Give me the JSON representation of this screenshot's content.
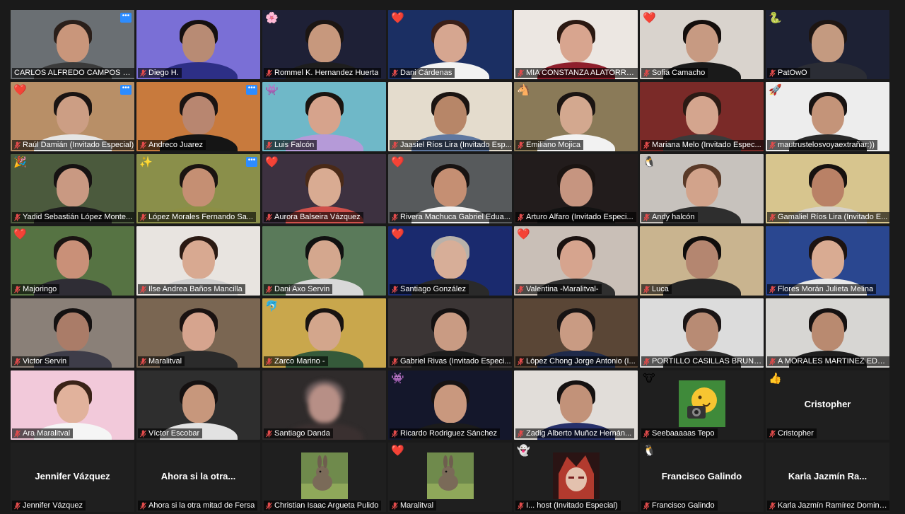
{
  "meeting": {
    "view": "gallery",
    "active_speaker": "CARLOS ALFREDO CAMPOS DE L..."
  },
  "participants": [
    {
      "name": "CARLOS ALFREDO CAMPOS DE L...",
      "video": true,
      "muted": false,
      "reaction": "",
      "menu": true,
      "active": true,
      "bg": "#6a6f73",
      "skin": "#c9967b",
      "hair": "#2a1f1a",
      "shirt": "#3b3b3b"
    },
    {
      "name": "Diego H.",
      "video": true,
      "muted": true,
      "reaction": "",
      "menu": false,
      "bg": "#7a6fd6",
      "skin": "#b88b74",
      "hair": "#151010",
      "shirt": "#2d2f86"
    },
    {
      "name": "Rommel K. Hernandez Huerta",
      "video": true,
      "muted": true,
      "reaction": "🌸",
      "menu": false,
      "bg": "#1e2036",
      "skin": "#c7987d",
      "hair": "#1b1513",
      "shirt": "#1e1e1e"
    },
    {
      "name": "Dani Cárdenas",
      "video": true,
      "muted": true,
      "reaction": "❤️",
      "menu": false,
      "bg": "#1b2f63",
      "skin": "#d6a690",
      "hair": "#3a1f18",
      "shirt": "#f2f2f2"
    },
    {
      "name": "MIA CONSTANZA ALATORRE ...",
      "video": true,
      "muted": true,
      "reaction": "",
      "menu": false,
      "bg": "#ece7e2",
      "skin": "#d8a58f",
      "hair": "#2b1912",
      "shirt": "#8f1f2c"
    },
    {
      "name": "Sofia Camacho",
      "video": true,
      "muted": true,
      "reaction": "❤️",
      "menu": false,
      "bg": "#d9d3cd",
      "skin": "#c79a82",
      "hair": "#140e0c",
      "shirt": "#1a1a1a"
    },
    {
      "name": "PatOwO",
      "video": true,
      "muted": true,
      "reaction": "🐍",
      "menu": false,
      "bg": "#1d2134",
      "skin": "#c49a80",
      "hair": "#1d1512",
      "shirt": "#2b2d35"
    },
    {
      "name": "Raúl Damián (Invitado Especial)",
      "video": true,
      "muted": true,
      "reaction": "❤️",
      "menu": true,
      "bg": "#b88f67",
      "skin": "#cc9e84",
      "hair": "#1a1412",
      "shirt": "#e5e5e5"
    },
    {
      "name": "Andreco Juarez",
      "video": true,
      "muted": true,
      "reaction": "",
      "menu": true,
      "bg": "#c87a3d",
      "skin": "#b88670",
      "hair": "#191312",
      "shirt": "#151515"
    },
    {
      "name": "Luis Falcón",
      "video": true,
      "muted": true,
      "reaction": "👾",
      "menu": false,
      "bg": "#6fb8c8",
      "skin": "#d6a38c",
      "hair": "#1a1410",
      "shirt": "#b59ad8"
    },
    {
      "name": "Jaasiel Ríos Lira (Invitado Esp...",
      "video": true,
      "muted": true,
      "reaction": "",
      "menu": false,
      "bg": "#e4dccd",
      "skin": "#b78668",
      "hair": "#1b1411",
      "shirt": "#5f78a0"
    },
    {
      "name": "Emiliano Mojica",
      "video": true,
      "muted": true,
      "reaction": "🐴",
      "menu": false,
      "bg": "#8a7a58",
      "skin": "#d3a88f",
      "hair": "#1a1412",
      "shirt": "#f2f2f2"
    },
    {
      "name": "Mariana Melo (Invitado Espec...",
      "video": true,
      "muted": true,
      "reaction": "",
      "menu": false,
      "bg": "#7a2a28",
      "skin": "#d4a58e",
      "hair": "#2b1a14",
      "shirt": "#3a3a3a"
    },
    {
      "name": "mautrustelosvoyaextrañar:))",
      "video": true,
      "muted": true,
      "reaction": "🚀",
      "menu": false,
      "bg": "#ededed",
      "skin": "#c49479",
      "hair": "#181312",
      "shirt": "#2a2a2a"
    },
    {
      "name": "Yadid Sebastián López Monte...",
      "video": true,
      "muted": true,
      "reaction": "🎉",
      "menu": false,
      "bg": "#4b5a3d",
      "skin": "#c99982",
      "hair": "#161212",
      "shirt": "#1d1d1d"
    },
    {
      "name": "López Morales Fernando Sa...",
      "video": true,
      "muted": true,
      "reaction": "✨",
      "menu": true,
      "bg": "#8a8f4a",
      "skin": "#c58f73",
      "hair": "#1b1411",
      "shirt": "#8c8f45"
    },
    {
      "name": "Aurora Balseira Vázquez",
      "video": true,
      "muted": true,
      "reaction": "❤️",
      "menu": false,
      "bg": "#3d3140",
      "skin": "#d9ab92",
      "hair": "#4a2a18",
      "shirt": "#d0504b"
    },
    {
      "name": "Rivera Machuca Gabriel Edua...",
      "video": true,
      "muted": true,
      "reaction": "❤️",
      "menu": false,
      "bg": "#575a5c",
      "skin": "#c58f73",
      "hair": "#181312",
      "shirt": "#f0f0f0"
    },
    {
      "name": "Arturo Alfaro (Invitado Especi...",
      "video": true,
      "muted": true,
      "reaction": "",
      "menu": false,
      "bg": "#221c1c",
      "skin": "#c69580",
      "hair": "#1a1412",
      "shirt": "#121212"
    },
    {
      "name": "Andy halcón",
      "video": true,
      "muted": true,
      "reaction": "🐧",
      "menu": false,
      "bg": "#c7c2bd",
      "skin": "#d2a38b",
      "hair": "#5a3a28",
      "shirt": "#2e2e2e"
    },
    {
      "name": "Gamaliel Ríos Lira (Invitado E...",
      "video": true,
      "muted": true,
      "reaction": "",
      "menu": false,
      "bg": "#d7c58e",
      "skin": "#b98166",
      "hair": "#171210",
      "shirt": "#d7d2c8"
    },
    {
      "name": "Majoringo",
      "video": true,
      "muted": true,
      "reaction": "❤️",
      "menu": false,
      "bg": "#567343",
      "skin": "#c99078",
      "hair": "#1a1412",
      "shirt": "#2f2d35"
    },
    {
      "name": "Ilse Andrea Baños Mancilla",
      "video": true,
      "muted": true,
      "reaction": "",
      "menu": false,
      "bg": "#e8e4e0",
      "skin": "#d8a991",
      "hair": "#2b1a13",
      "shirt": "#cfcfcf"
    },
    {
      "name": "Dani Axo Servin",
      "video": true,
      "muted": true,
      "reaction": "",
      "menu": false,
      "bg": "#5a7a5a",
      "skin": "#d4a78e",
      "hair": "#111111",
      "shirt": "#d8d8d8"
    },
    {
      "name": "Santiago González",
      "video": true,
      "muted": true,
      "reaction": "❤️",
      "menu": false,
      "bg": "#1a2a6e",
      "skin": "#d7ae98",
      "hair": "#b8b1aa",
      "shirt": "#2a2a2a"
    },
    {
      "name": "Valentina -Maralitval-",
      "video": true,
      "muted": true,
      "reaction": "❤️",
      "menu": false,
      "bg": "#c9bfb7",
      "skin": "#d6a48e",
      "hair": "#1a1210",
      "shirt": "#2f2f2f"
    },
    {
      "name": "Luca",
      "video": true,
      "muted": true,
      "reaction": "",
      "menu": false,
      "bg": "#c9b48f",
      "skin": "#b48670",
      "hair": "#0f0d0c",
      "shirt": "#252525"
    },
    {
      "name": "Flores Morán Julieta Melina",
      "video": true,
      "muted": true,
      "reaction": "",
      "menu": false,
      "bg": "#2a4790",
      "skin": "#d9ab92",
      "hair": "#1c1311",
      "shirt": "#e8e8e8"
    },
    {
      "name": "Victor Servin",
      "video": true,
      "muted": true,
      "reaction": "",
      "menu": false,
      "bg": "#8a8078",
      "skin": "#aa7c68",
      "hair": "#141111",
      "shirt": "#3e3d49"
    },
    {
      "name": "Maralitval",
      "video": true,
      "muted": true,
      "reaction": "",
      "menu": false,
      "bg": "#7a6652",
      "skin": "#d6a48e",
      "hair": "#1a1211",
      "shirt": "#2b2b2b"
    },
    {
      "name": "Zarco Marino -",
      "video": true,
      "muted": true,
      "reaction": "🐬",
      "menu": false,
      "bg": "#c9a74c",
      "skin": "#d3a68c",
      "hair": "#181311",
      "shirt": "#355a3a"
    },
    {
      "name": "Gabriel Rivas (Invitado Especi...",
      "video": true,
      "muted": true,
      "reaction": "",
      "menu": false,
      "bg": "#3b3535",
      "skin": "#c99b83",
      "hair": "#141111",
      "shirt": "#1d1d1d"
    },
    {
      "name": "López Chong Jorge Antonio (I...",
      "video": true,
      "muted": true,
      "reaction": "",
      "menu": false,
      "bg": "#5a4636",
      "skin": "#c99b83",
      "hair": "#171313",
      "shirt": "#1f2a4a"
    },
    {
      "name": "PORTILLO CASILLAS BRUNO E...",
      "video": true,
      "muted": true,
      "reaction": "",
      "menu": false,
      "bg": "#dcdcdc",
      "skin": "#b88b74",
      "hair": "#1b1515",
      "shirt": "#2b2b2b"
    },
    {
      "name": "A MORALES MARTINEZ EDGA...",
      "video": true,
      "muted": true,
      "reaction": "",
      "menu": false,
      "bg": "#d7d6d3",
      "skin": "#b98a70",
      "hair": "#151111",
      "shirt": "#1e1e1e"
    },
    {
      "name": "Ara Maralitval",
      "video": true,
      "muted": true,
      "reaction": "",
      "menu": false,
      "bg": "#f2c9da",
      "skin": "#e1b29c",
      "hair": "#3a2318",
      "shirt": "#f5f5f5"
    },
    {
      "name": "Víctor Escobar",
      "video": true,
      "muted": true,
      "reaction": "",
      "menu": false,
      "bg": "#2e2e2e",
      "skin": "#c7977c",
      "hair": "#151111",
      "shirt": "#e2e2e2"
    },
    {
      "name": "Santiago Danda",
      "video": true,
      "muted": true,
      "reaction": "",
      "menu": false,
      "bg": "#2f2b2b",
      "skin": "#b78f86",
      "hair": "#6a5a5a",
      "shirt": "#3a3030",
      "blurred": true
    },
    {
      "name": "Ricardo Rodriguez Sánchez",
      "video": true,
      "muted": true,
      "reaction": "👾",
      "menu": false,
      "bg": "#14172b",
      "skin": "#c9987e",
      "hair": "#171313",
      "shirt": "#1b1b1b"
    },
    {
      "name": "Zadig Alberto Muñoz Hernán...",
      "video": true,
      "muted": true,
      "reaction": "",
      "menu": false,
      "bg": "#e1ddd9",
      "skin": "#c29279",
      "hair": "#151111",
      "shirt": "#27306a"
    },
    {
      "name": "Seebaaaaas Tepo",
      "video": false,
      "muted": true,
      "reaction": "🐮",
      "menu": false,
      "bg": "#1f1f1f",
      "avatar": "emoji-camera"
    },
    {
      "name": "Cristopher",
      "video": false,
      "muted": true,
      "reaction": "👍",
      "menu": false,
      "bg": "#1f1f1f",
      "center_label": "Cristopher"
    },
    {
      "name": "Jennifer Vázquez",
      "video": false,
      "muted": true,
      "reaction": "",
      "menu": false,
      "bg": "#1f1f1f",
      "center_label": "Jennifer Vázquez"
    },
    {
      "name": "Ahora si la otra mitad de Fersa",
      "video": false,
      "muted": true,
      "reaction": "",
      "menu": false,
      "bg": "#1f1f1f",
      "center_label": "Ahora si la otra..."
    },
    {
      "name": "Christian Isaac Argueta Pulido",
      "video": false,
      "muted": true,
      "reaction": "",
      "menu": false,
      "bg": "#1f1f1f",
      "avatar": "rabbit"
    },
    {
      "name": "Maralitval",
      "video": false,
      "muted": true,
      "reaction": "❤️",
      "menu": false,
      "bg": "#1f1f1f",
      "avatar": "rabbit"
    },
    {
      "name": "I... host (Invitado Especial)",
      "video": false,
      "muted": true,
      "reaction": "👻",
      "menu": false,
      "bg": "#1f1f1f",
      "avatar": "anime"
    },
    {
      "name": "Francisco Galindo",
      "video": false,
      "muted": true,
      "reaction": "🐧",
      "menu": false,
      "bg": "#1f1f1f",
      "center_label": "Francisco Galindo"
    },
    {
      "name": "Karla Jazmín Ramírez Doming...",
      "video": false,
      "muted": true,
      "reaction": "",
      "menu": false,
      "bg": "#1f1f1f",
      "center_label": "Karla Jazmín Ra..."
    }
  ]
}
